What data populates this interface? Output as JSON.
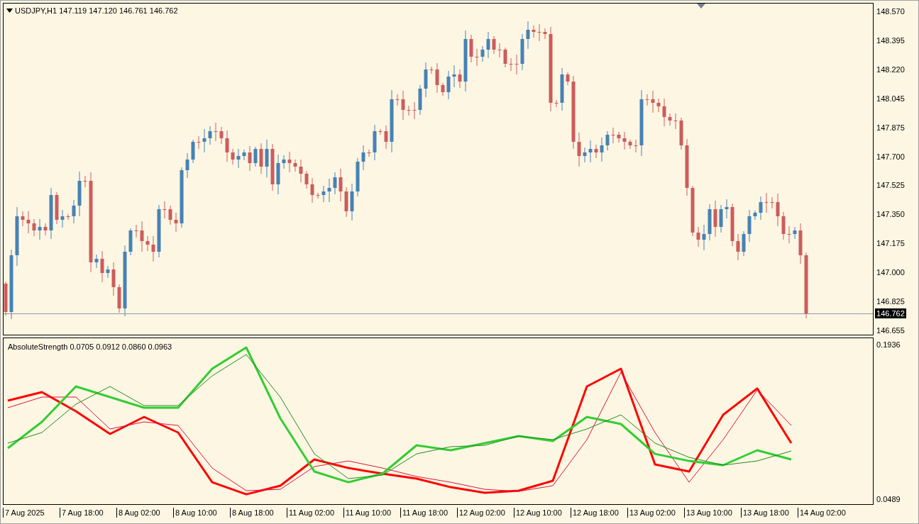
{
  "price_pane": {
    "header": "USDJPY,H1 147.119 147.120 146.761 146.762",
    "price_ticks": [
      "148.570",
      "148.395",
      "148.220",
      "148.045",
      "147.875",
      "147.700",
      "147.525",
      "147.350",
      "147.175",
      "147.000",
      "146.825",
      "146.655"
    ],
    "current_price": "146.762"
  },
  "indicator_pane": {
    "header": "AbsoluteStrength 0.0705 0.0912 0.0860 0.0963",
    "scale_labels": [
      "0.1936",
      "0.0489"
    ]
  },
  "time_axis": {
    "labels": [
      "7 Aug 2025",
      "7 Aug 18:00",
      "8 Aug 02:00",
      "8 Aug 10:00",
      "8 Aug 18:00",
      "11 Aug 02:00",
      "11 Aug 10:00",
      "11 Aug 18:00",
      "12 Aug 02:00",
      "12 Aug 10:00",
      "12 Aug 18:00",
      "13 Aug 02:00",
      "13 Aug 10:00",
      "13 Aug 18:00",
      "14 Aug 02:00"
    ]
  }
}
